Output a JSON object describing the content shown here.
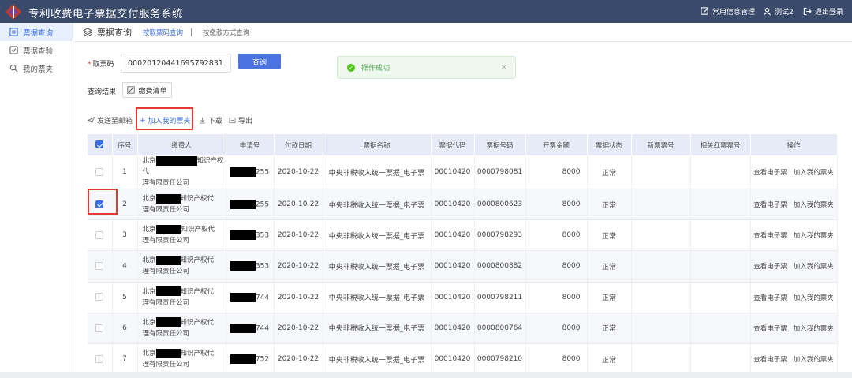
{
  "app": {
    "title": "专利收费电子票据交付服务系统",
    "nav": [
      {
        "label": "常用信息管理",
        "icon": "edit-icon"
      },
      {
        "label": "测试2",
        "icon": "user-icon"
      },
      {
        "label": "退出登录",
        "icon": "logout-icon"
      }
    ]
  },
  "sidebar": {
    "items": [
      {
        "label": "票据查询",
        "icon": "list-icon",
        "active": true
      },
      {
        "label": "票据查验",
        "icon": "check-square-icon",
        "active": false
      },
      {
        "label": "我的票夹",
        "icon": "search-icon",
        "active": false
      }
    ]
  },
  "header": {
    "title": "票据查询",
    "tabs": [
      {
        "label": "按取票码查询",
        "active": true
      },
      {
        "label": "按缴款方式查询",
        "active": false
      }
    ]
  },
  "query": {
    "label": "取票码",
    "required_mark": "*",
    "ticket_code": "00020120441695792831",
    "query_button": "查询"
  },
  "toast": {
    "message": "操作成功",
    "close": "×"
  },
  "result": {
    "label": "查询结果",
    "list_button": "缴费清单"
  },
  "toolbar": {
    "send_email": "发送至邮箱",
    "add_folder": "加入我的票夹",
    "download": "下载",
    "export": "导出"
  },
  "table": {
    "columns": [
      "序号",
      "缴费人",
      "申请号",
      "付款日期",
      "票据名称",
      "票据代码",
      "票据号码",
      "开票金额",
      "票据状态",
      "新票票号",
      "相关红票票号",
      "操作"
    ],
    "rows": [
      {
        "seq": "1",
        "payer_a": "北京",
        "payer_b": "知识产权代",
        "payer_c": "理有限责任公司",
        "app_no": "255",
        "date": "2020-10-22",
        "name": "中央非税收入统一票据_电子票",
        "code": "00010420",
        "number": "0000798081",
        "amount": "8000",
        "status": "正常",
        "checked": false
      },
      {
        "seq": "2",
        "payer_a": "北京",
        "payer_b": "知识产权代",
        "payer_c": "理有限责任公司",
        "app_no": "255",
        "date": "2020-10-22",
        "name": "中央非税收入统一票据_电子票",
        "code": "00010420",
        "number": "0000800623",
        "amount": "8000",
        "status": "正常",
        "checked": true
      },
      {
        "seq": "3",
        "payer_a": "北京",
        "payer_b": "知识产权代",
        "payer_c": "理有限责任公司",
        "app_no": "353",
        "date": "2020-10-22",
        "name": "中央非税收入统一票据_电子票",
        "code": "00010420",
        "number": "0000798293",
        "amount": "8000",
        "status": "正常",
        "checked": false
      },
      {
        "seq": "4",
        "payer_a": "北京",
        "payer_b": "知识产权代",
        "payer_c": "理有限责任公司",
        "app_no": "353",
        "date": "2020-10-22",
        "name": "中央非税收入统一票据_电子票",
        "code": "00010420",
        "number": "0000800882",
        "amount": "8000",
        "status": "正常",
        "checked": false
      },
      {
        "seq": "5",
        "payer_a": "北京",
        "payer_b": "知识产权代",
        "payer_c": "理有限责任公司",
        "app_no": "744",
        "date": "2020-10-22",
        "name": "中央非税收入统一票据_电子票",
        "code": "00010420",
        "number": "0000798211",
        "amount": "8000",
        "status": "正常",
        "checked": false
      },
      {
        "seq": "6",
        "payer_a": "北京",
        "payer_b": "知识产权代",
        "payer_c": "理有限责任公司",
        "app_no": "744",
        "date": "2020-10-22",
        "name": "中央非税收入统一票据_电子票",
        "code": "00010420",
        "number": "0000800764",
        "amount": "8000",
        "status": "正常",
        "checked": false
      },
      {
        "seq": "7",
        "payer_a": "北京",
        "payer_b": "知识产权代",
        "payer_c": "理有限责任公司",
        "app_no": "752",
        "date": "2020-10-22",
        "name": "中央非税收入统一票据_电子票",
        "code": "00010420",
        "number": "0000798210",
        "amount": "8000",
        "status": "正常",
        "checked": false
      }
    ],
    "ops": {
      "view": "查看电子票",
      "add": "加入我的票夹"
    }
  },
  "colors": {
    "topbar": "#3a4a6b",
    "accent": "#3b6ee6",
    "highlight_box": "#e53935",
    "success": "#52c41a"
  }
}
